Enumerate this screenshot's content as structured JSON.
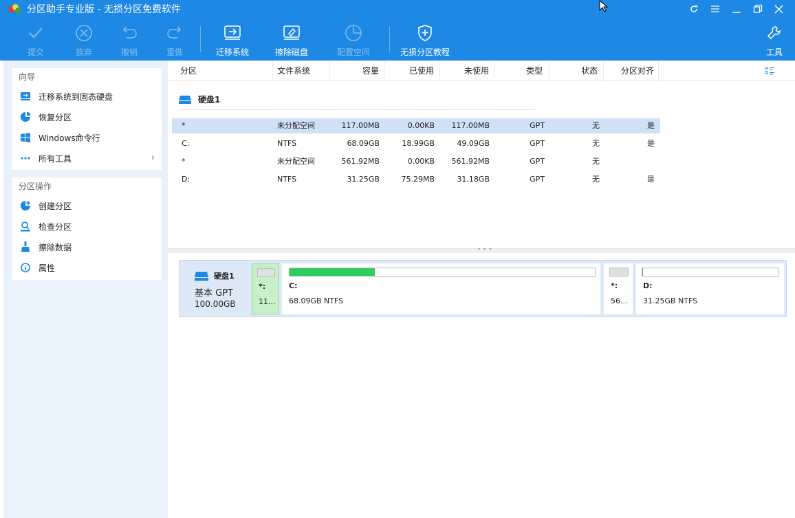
{
  "window": {
    "title": "分区助手专业版 - 无损分区免费软件",
    "controls": [
      "refresh-icon",
      "menu-icon",
      "minimize-icon",
      "restore-icon",
      "close-icon"
    ]
  },
  "toolbar": {
    "commit": "提交",
    "discard": "放弃",
    "undo": "撤销",
    "redo": "重做",
    "migrate": "迁移系统",
    "wipe": "擦除磁盘",
    "allocate": "配置空间",
    "tutorial": "无损分区教程",
    "tools": "工具"
  },
  "sidebar": {
    "wizard": {
      "heading": "向导",
      "items": [
        {
          "label": "迁移系统到固态硬盘",
          "icon": "migrate-ssd-icon"
        },
        {
          "label": "恢复分区",
          "icon": "recover-partition-icon"
        },
        {
          "label": "Windows命令行",
          "icon": "windows-icon"
        },
        {
          "label": "所有工具",
          "icon": "more-dots-icon"
        }
      ]
    },
    "operations": {
      "heading": "分区操作",
      "items": [
        {
          "label": "创建分区",
          "icon": "create-partition-icon"
        },
        {
          "label": "检查分区",
          "icon": "check-partition-icon"
        },
        {
          "label": "擦除数据",
          "icon": "wipe-data-icon"
        },
        {
          "label": "属性",
          "icon": "info-icon"
        }
      ]
    }
  },
  "table": {
    "headers": {
      "partition": "分区",
      "filesystem": "文件系统",
      "capacity": "容量",
      "used": "已使用",
      "unused": "未使用",
      "type": "类型",
      "status": "状态",
      "aligned": "分区对齐"
    },
    "disk_label": "硬盘1",
    "rows": [
      {
        "partition": "*",
        "filesystem": "未分配空间",
        "capacity": "117.00MB",
        "used": "0.00KB",
        "unused": "117.00MB",
        "type": "GPT",
        "status": "无",
        "aligned": "是"
      },
      {
        "partition": "C:",
        "filesystem": "NTFS",
        "capacity": "68.09GB",
        "used": "18.99GB",
        "unused": "49.09GB",
        "type": "GPT",
        "status": "无",
        "aligned": "是"
      },
      {
        "partition": "*",
        "filesystem": "未分配空间",
        "capacity": "561.92MB",
        "used": "0.00KB",
        "unused": "561.92MB",
        "type": "GPT",
        "status": "无",
        "aligned": ""
      },
      {
        "partition": "D:",
        "filesystem": "NTFS",
        "capacity": "31.25GB",
        "used": "75.29MB",
        "unused": "31.18GB",
        "type": "GPT",
        "status": "无",
        "aligned": "是"
      }
    ]
  },
  "diskmap": {
    "disk": {
      "name": "硬盘1",
      "kind": "基本 GPT",
      "size": "100.00GB"
    },
    "partitions": [
      {
        "name": "*:",
        "info": "11...",
        "used_fraction": 0
      },
      {
        "name": "C:",
        "info": "68.09GB NTFS",
        "used_fraction": 0.279
      },
      {
        "name": "*:",
        "info": "56...",
        "used_fraction": 0
      },
      {
        "name": "D:",
        "info": "31.25GB NTFS",
        "used_fraction": 0.002
      }
    ]
  },
  "colors": {
    "accent": "#1e88e5",
    "selected_row": "#cfe0f7",
    "used_bar": "#2ecc5c",
    "unalloc_selected": "#c8f0c8"
  }
}
